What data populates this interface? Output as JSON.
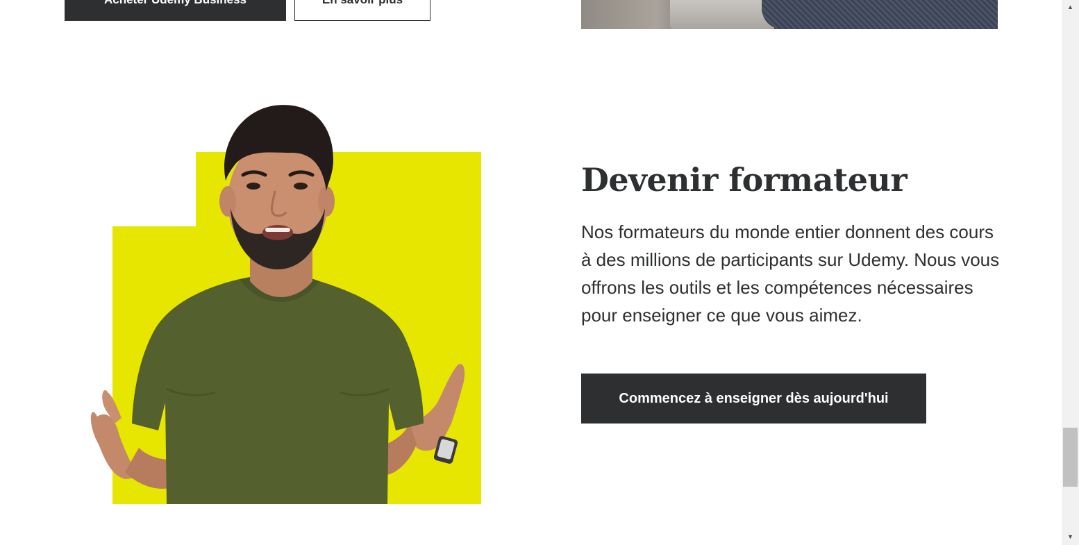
{
  "top_buttons": {
    "business_label": "Acheter Udemy Business",
    "learn_more_label": "En savoir plus"
  },
  "instructor_section": {
    "title": "Devenir formateur",
    "description": "Nos formateurs du monde entier donnent des cours à des millions de participants sur Udemy. Nous vous offrons les outils et les compétences nécessaires pour enseigner ce que vous aimez.",
    "cta_label": "Commencez à enseigner dès aujourd'hui"
  },
  "colors": {
    "accent_yellow": "#e6e600",
    "dark": "#2d2f31",
    "shirt": "#55602f"
  },
  "icons": {
    "scroll_up": "triangle-up",
    "scroll_down": "triangle-down"
  }
}
